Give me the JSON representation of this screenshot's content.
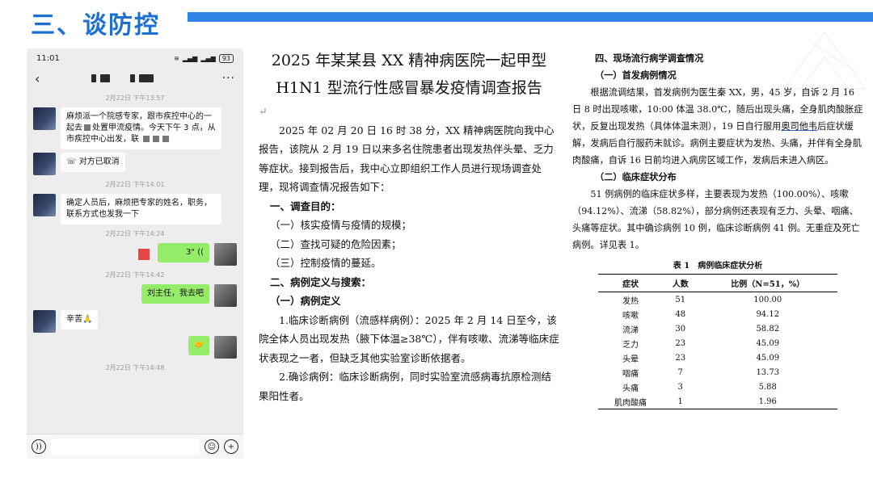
{
  "slide": {
    "title": "三、谈防控"
  },
  "phone": {
    "time": "11:01",
    "battery": "93",
    "ts1": "2月22日 下午13:57",
    "msg1": "麻烦派一个院感专家，跟市疾控中心的一起去",
    "msg1b": "处置甲流疫情。今天下午 3 点，从市疾控中心出发，联",
    "cancel": "对方已取消",
    "ts2": "2月22日 下午14:01",
    "msg2": "确定人员后，麻烦把专家的姓名，职务，联系方式也发我一下",
    "ts3": "2月22日 下午14:24",
    "voice": "3\"",
    "ts4": "2月22日 下午14:42",
    "msg3": "刘主任，我去吧",
    "msg4": "辛苦🙏",
    "ts5": "2月22日 下午14:48"
  },
  "doc1": {
    "title1": "2025 年某某县 XX 精神病医院一起甲型",
    "title2": "H1N1 型流行性感冒暴发疫情调查报告",
    "intro": "2025 年 02 月 20 日 16 时 38 分，XX 精神病医院向我中心报告，该院从 2 月 19 日以来多名住院患者出现发热伴头晕、乏力等症状。接到报告后，我中心立即组织工作人员进行现场调查处理，现将调查情况报告如下：",
    "s1": "一、调查目的：",
    "s1a": "（一）核实疫情与疫情的规模；",
    "s1b": "（二）查找可疑的危险因素；",
    "s1c": "（三）控制疫情的蔓延。",
    "s2": "二、病例定义与搜索：",
    "s2a": "（一）病例定义",
    "p1": "1.临床诊断病例（流感样病例）：2025 年 2 月 14 日至今，该院全体人员出现发热（腋下体温≥38℃），伴有咳嗽、流涕等临床症状表现之一者，但缺乏其他实验室诊断依据者。",
    "p2": "2.确诊病例：临床诊断病例，同时实验室流感病毒抗原检测结果阳性者。"
  },
  "doc2": {
    "s4": "四、现场流行病学调查情况",
    "s4a": "（一）首发病例情况",
    "p1a": "根据流调结果，首发病例为医生秦 XX，男，45 岁，自诉 2 月 16 日 8 时出现咳嗽，10:00 体温 38.0℃，随后出现头痛，全身肌肉酸胀症状，反复出现发热（具体体温未测），19 日自行服用",
    "drug": "奥司他韦",
    "p1b": "后症状缓解，发病后自行服药未就诊。病例主要症状为发热、头痛，并伴有全身肌肉酸痛，自诉 16 日前均进入病房区域工作，发病后未进入病区。",
    "s4b": "（二）临床症状分布",
    "p2": "51 例病例的临床症状多样，主要表现为发热（100.00%）、咳嗽（94.12%）、流涕（58.82%），部分病例还表现有乏力、头晕、咽痛、头痛等症状。其中确诊病例 10 例，临床诊断病例 41 例。无重症及死亡病例。详见表 1。",
    "table_caption": "表 1　病例临床症状分析",
    "headers": [
      "症状",
      "人数",
      "比例（N=51，%）"
    ],
    "rows": [
      [
        "发热",
        "51",
        "100.00"
      ],
      [
        "咳嗽",
        "48",
        "94.12"
      ],
      [
        "流涕",
        "30",
        "58.82"
      ],
      [
        "乏力",
        "23",
        "45.09"
      ],
      [
        "头晕",
        "23",
        "45.09"
      ],
      [
        "咽痛",
        "7",
        "13.73"
      ],
      [
        "头痛",
        "3",
        "5.88"
      ],
      [
        "肌肉酸痛",
        "1",
        "1.96"
      ]
    ]
  }
}
